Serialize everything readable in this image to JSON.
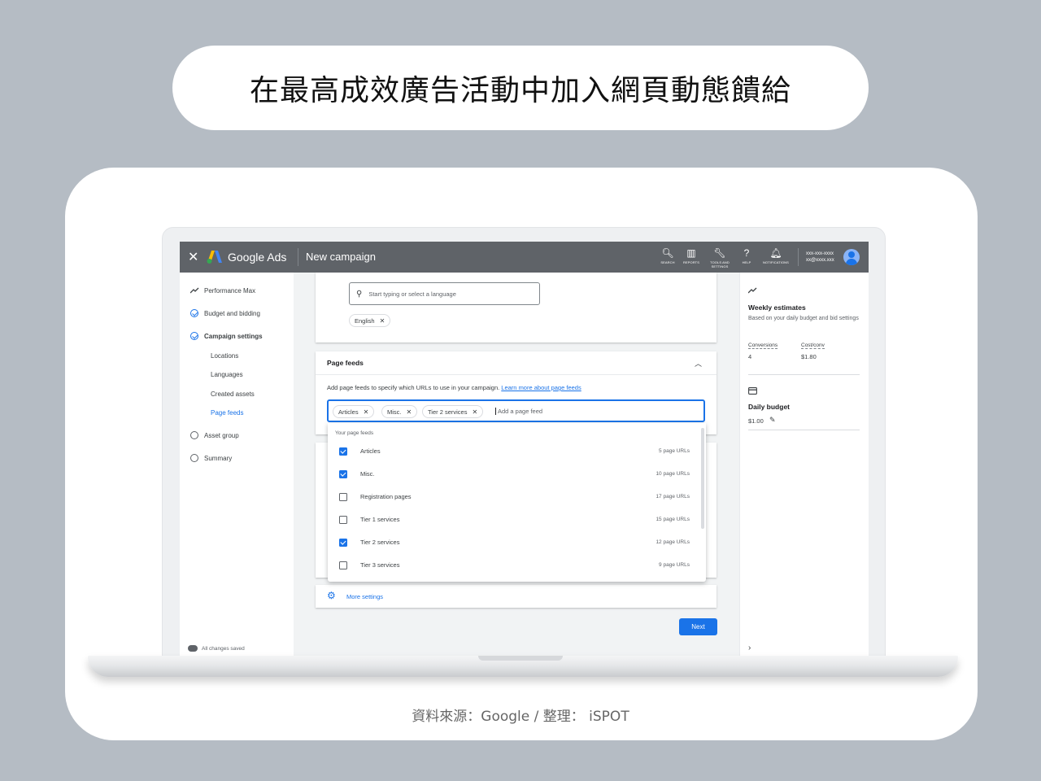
{
  "headline": "在最高成效廣告活動中加入網頁動態饋給",
  "source_credit": "資料來源：Google / 整理： iSPOT",
  "app": {
    "brand": "Google Ads",
    "campaign_title": "New campaign",
    "close_glyph": "✕",
    "tools": [
      {
        "icon": "search-icon",
        "glyph": "🔍︎",
        "label": "SEARCH"
      },
      {
        "icon": "reports-icon",
        "glyph": "▥",
        "label": "REPORTS"
      },
      {
        "icon": "wrench-icon",
        "glyph": "🔧︎",
        "label": "TOOLS AND SETTINGS"
      },
      {
        "icon": "help-icon",
        "glyph": "?",
        "label": "HELP"
      },
      {
        "icon": "bell-icon",
        "glyph": "🔔︎",
        "label": "NOTIFICATIONS"
      }
    ],
    "account": {
      "id": "xxx-xxx-xxxx",
      "email": "xx@xxxx.xxx"
    }
  },
  "left_nav": {
    "items": [
      {
        "label": "Performance Max",
        "icon": "trend-icon",
        "state": "icon"
      },
      {
        "label": "Budget and bidding",
        "state": "done"
      },
      {
        "label": "Campaign settings",
        "state": "done",
        "bold": true
      },
      {
        "label": "Asset group",
        "state": "empty"
      },
      {
        "label": "Summary",
        "state": "empty"
      }
    ],
    "sub_items": [
      "Locations",
      "Languages",
      "Created assets",
      "Page feeds"
    ],
    "active_sub": "Page feeds",
    "saved_status": "All changes saved"
  },
  "languages": {
    "search_placeholder": "Start typing or select a language",
    "selected_chip": "English"
  },
  "page_feeds": {
    "header": "Page feeds",
    "description": "Add page feeds to specify which URLs to use in your campaign.",
    "learn_more": "Learn more about page feeds",
    "chips": [
      "Articles",
      "Misc.",
      "Tier 2 services"
    ],
    "input_placeholder": "Add a page feed",
    "dropdown_title": "Your page feeds",
    "feeds": [
      {
        "name": "Articles",
        "count": "5 page URLs",
        "checked": true
      },
      {
        "name": "Misc.",
        "count": "10 page URLs",
        "checked": true
      },
      {
        "name": "Registration pages",
        "count": "17 page URLs",
        "checked": false
      },
      {
        "name": "Tier 1 services",
        "count": "15 page URLs",
        "checked": false
      },
      {
        "name": "Tier 2 services",
        "count": "12 page URLs",
        "checked": true
      },
      {
        "name": "Tier 3 services",
        "count": "9 page URLs",
        "checked": false
      }
    ]
  },
  "more_settings": "More settings",
  "next_button": "Next",
  "right_panel": {
    "weekly_title": "Weekly estimates",
    "weekly_sub": "Based on your daily budget and bid settings",
    "conversions_label": "Conversions",
    "conversions_value": "4",
    "costconv_label": "Cost/conv",
    "costconv_value": "$1.80",
    "budget_title": "Daily budget",
    "budget_value": "$1.00"
  },
  "colors": {
    "accent": "#1a73e8",
    "topbar": "#5f6368",
    "backdrop": "#b5bcc4"
  }
}
